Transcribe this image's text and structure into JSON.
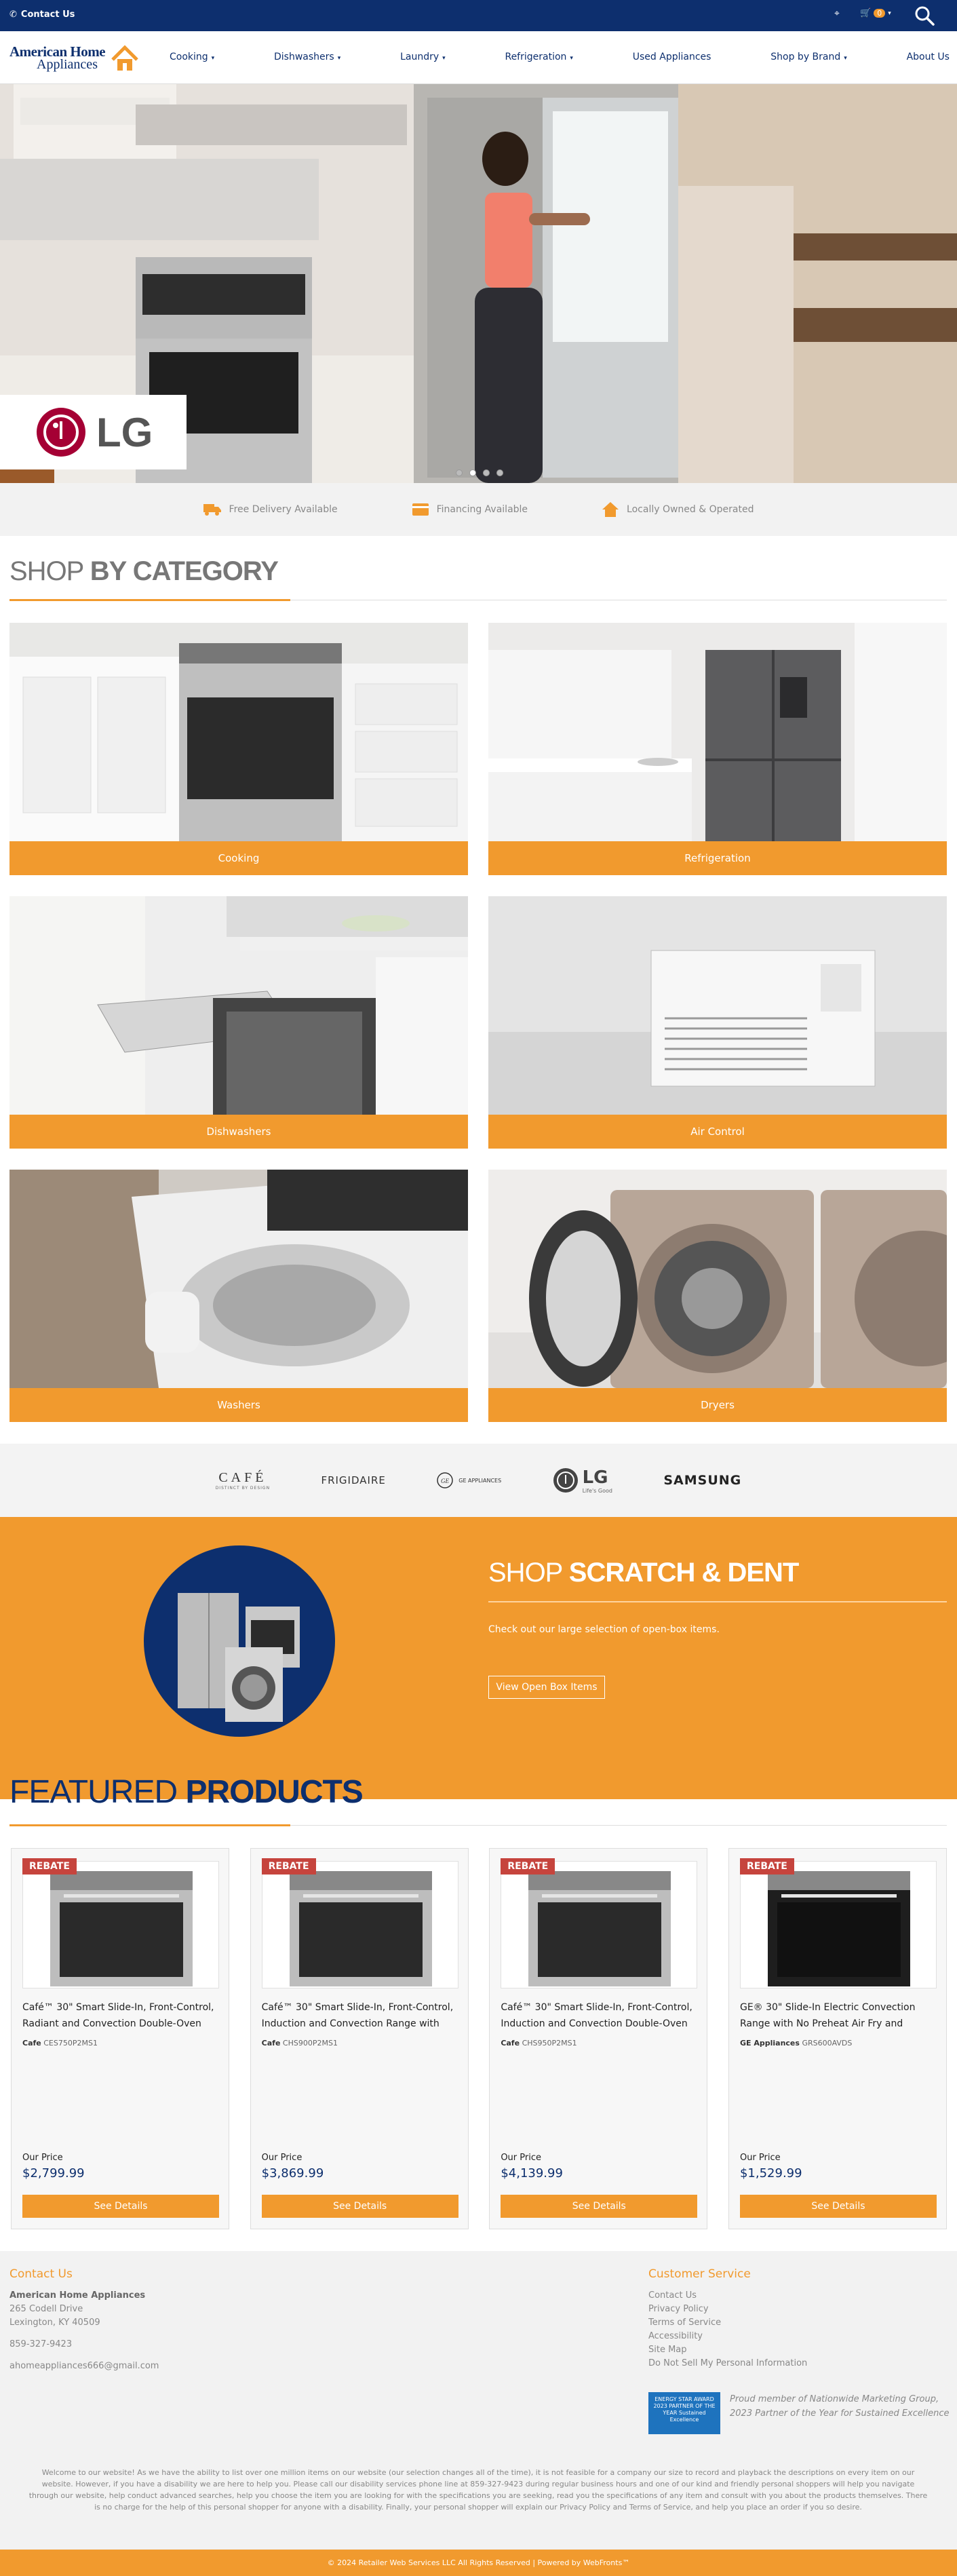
{
  "topbar": {
    "contact": "Contact Us",
    "cart_count": "0"
  },
  "header": {
    "logo_line1": "American Home",
    "logo_line2": "Appliances",
    "nav": [
      "Cooking",
      "Dishwashers",
      "Laundry",
      "Refrigeration",
      "Used Appliances",
      "Shop by Brand",
      "About Us"
    ],
    "nav_has_dropdown": [
      true,
      true,
      true,
      true,
      false,
      true,
      false
    ]
  },
  "hero": {
    "brand_badge": "LG",
    "slides": 4,
    "active_slide": 2
  },
  "perks": [
    {
      "icon": "truck-icon",
      "label": "Free Delivery Available"
    },
    {
      "icon": "credit-card-icon",
      "label": "Financing Available"
    },
    {
      "icon": "house-icon",
      "label": "Locally Owned & Operated"
    }
  ],
  "categories_title": {
    "light": "SHOP",
    "bold": "BY CATEGORY"
  },
  "categories": [
    "Cooking",
    "Refrigeration",
    "Dishwashers",
    "Air Control",
    "Washers",
    "Dryers"
  ],
  "brands": [
    "CAFÉ",
    "FRIGIDAIRE",
    "GE APPLIANCES",
    "LG",
    "SAMSUNG"
  ],
  "brand_sub": {
    "cafe": "DISTINCT BY DESIGN",
    "lg": "Life's Good"
  },
  "scratch": {
    "title_light": "SHOP",
    "title_bold": "SCRATCH & DENT",
    "desc": "Check out our large selection of open-box items.",
    "button": "View Open Box Items"
  },
  "featured_title": {
    "light": "FEATURED",
    "bold": "PRODUCTS"
  },
  "products": [
    {
      "badge": "REBATE",
      "name": "Café™ 30\" Smart Slide-In, Front-Control, Radiant and Convection Double-Oven",
      "brand": "Cafe",
      "sku": "CES750P2MS1",
      "price_label": "Our Price",
      "price": "$2,799.99",
      "button": "See Details",
      "dark": false
    },
    {
      "badge": "REBATE",
      "name": "Café™ 30\" Smart Slide-In, Front-Control, Induction and Convection Range with",
      "brand": "Cafe",
      "sku": "CHS900P2MS1",
      "price_label": "Our Price",
      "price": "$3,869.99",
      "button": "See Details",
      "dark": false
    },
    {
      "badge": "REBATE",
      "name": "Café™ 30\" Smart Slide-In, Front-Control, Induction and Convection Double-Oven",
      "brand": "Cafe",
      "sku": "CHS950P2MS1",
      "price_label": "Our Price",
      "price": "$4,139.99",
      "button": "See Details",
      "dark": false
    },
    {
      "badge": "REBATE",
      "name": "GE® 30\" Slide-In Electric Convection Range with No Preheat Air Fry and",
      "brand": "GE Appliances",
      "sku": "GRS600AVDS",
      "price_label": "Our Price",
      "price": "$1,529.99",
      "button": "See Details",
      "dark": true
    }
  ],
  "footer": {
    "contact_title": "Contact Us",
    "company": "American Home Appliances",
    "street": "265 Codell Drive",
    "city": "Lexington, KY 40509",
    "phone": "859-327-9423",
    "email": "ahomeappliances666@gmail.com",
    "service_title": "Customer Service",
    "links": [
      "Contact Us",
      "Privacy Policy",
      "Terms of Service",
      "Accessibility",
      "Site Map",
      "Do Not Sell My Personal Information"
    ],
    "energy_star": "ENERGY STAR AWARD 2023 PARTNER OF THE YEAR Sustained Excellence",
    "promo": "Proud member of Nationwide Marketing Group, 2023 Partner of the Year for Sustained Excellence",
    "disclaimer": "Welcome to our website! As we have the ability to list over one million items on our website (our selection changes all of the time), it is not feasible for a company our size to record and playback the descriptions on every item on our website. However, if you have a disability we are here to help you. Please call our disability services phone line at 859-327-9423 during regular business hours and one of our kind and friendly personal shoppers will help you navigate through our website, help conduct advanced searches, help you choose the item you are looking for with the specifications you are seeking, read you the specifications of any item and consult with you about the products themselves. There is no charge for the help of this personal shopper for anyone with a disability. Finally, your personal shopper will explain our Privacy Policy and Terms of Service, and help you place an order if you so desire.",
    "copyright": "© 2024 Retailer Web Services LLC All Rights Reserved | Powered by WebFronts™"
  },
  "colors": {
    "navy": "#0d2f6e",
    "orange": "#f19a2e",
    "rebate": "#c6443d"
  }
}
